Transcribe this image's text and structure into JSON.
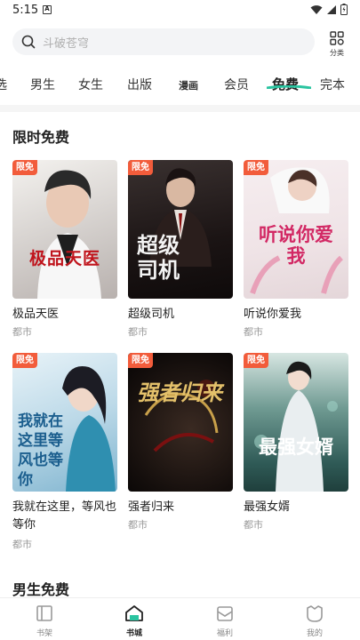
{
  "status": {
    "time": "5:15",
    "notification_glyph": "A"
  },
  "search": {
    "placeholder": "斗破苍穹",
    "category_label": "分类"
  },
  "tabs": [
    "选",
    "男生",
    "女生",
    "出版",
    "漫画",
    "会员",
    "免费",
    "完本"
  ],
  "active_tab": "免费",
  "accent_color": "#2bc4a0",
  "badge_color": "#f25c3b",
  "sections": {
    "limited_free": {
      "title": "限时免费",
      "books": [
        {
          "title": "极品天医",
          "genre": "都市",
          "badge": "限免",
          "cover_text": "极品天医"
        },
        {
          "title": "超级司机",
          "genre": "都市",
          "badge": "限免",
          "cover_text": "超级司机"
        },
        {
          "title": "听说你爱我",
          "genre": "都市",
          "badge": "限免",
          "cover_text": "听说你爱我"
        },
        {
          "title": "我就在这里，等风也等你",
          "genre": "都市",
          "badge": "限免",
          "cover_text": "我就在这里等风也等你"
        },
        {
          "title": "强者归来",
          "genre": "都市",
          "badge": "限免",
          "cover_text": "强者归来"
        },
        {
          "title": "最强女婿",
          "genre": "都市",
          "badge": "限免",
          "cover_text": "最强女婿"
        }
      ]
    },
    "male_free": {
      "title": "男生免费"
    }
  },
  "bottom_nav": [
    {
      "label": "书架",
      "icon": "bookshelf-icon",
      "active": false
    },
    {
      "label": "书城",
      "icon": "bookstore-icon",
      "active": true
    },
    {
      "label": "福利",
      "icon": "gift-icon",
      "active": false
    },
    {
      "label": "我的",
      "icon": "profile-icon",
      "active": false
    }
  ]
}
